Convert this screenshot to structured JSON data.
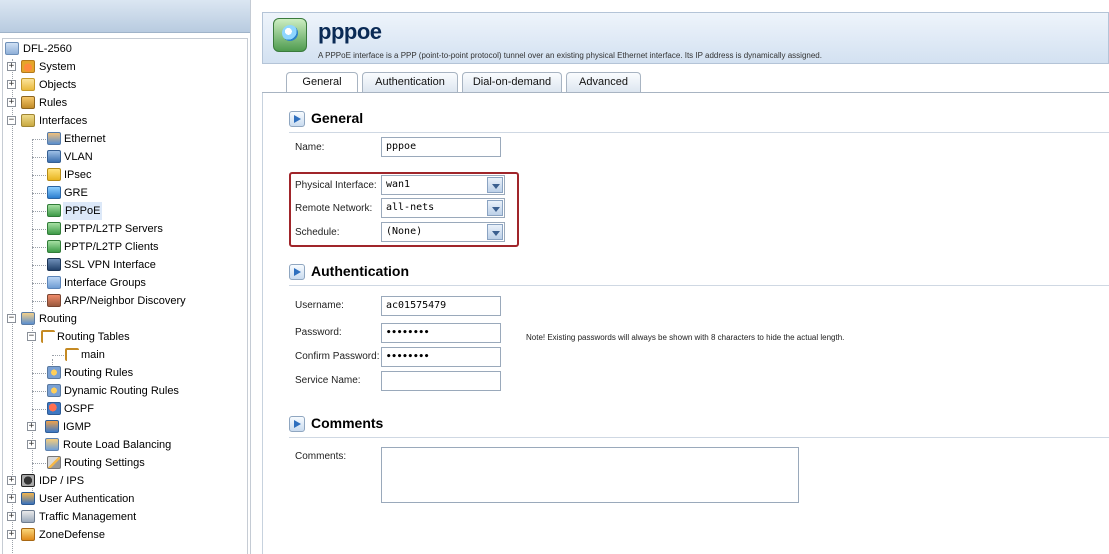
{
  "tree": {
    "items": [
      {
        "label": "DFL-2560"
      },
      {
        "label": "System"
      },
      {
        "label": "Objects"
      },
      {
        "label": "Rules"
      },
      {
        "label": "Interfaces"
      },
      {
        "label": "Ethernet"
      },
      {
        "label": "VLAN"
      },
      {
        "label": "IPsec"
      },
      {
        "label": "GRE"
      },
      {
        "label": "PPPoE"
      },
      {
        "label": "PPTP/L2TP Servers"
      },
      {
        "label": "PPTP/L2TP Clients"
      },
      {
        "label": "SSL VPN Interface"
      },
      {
        "label": "Interface Groups"
      },
      {
        "label": "ARP/Neighbor Discovery"
      },
      {
        "label": "Routing"
      },
      {
        "label": "Routing Tables"
      },
      {
        "label": "main"
      },
      {
        "label": "Routing Rules"
      },
      {
        "label": "Dynamic Routing Rules"
      },
      {
        "label": "OSPF"
      },
      {
        "label": "IGMP"
      },
      {
        "label": "Route Load Balancing"
      },
      {
        "label": "Routing Settings"
      },
      {
        "label": "IDP / IPS"
      },
      {
        "label": "User Authentication"
      },
      {
        "label": "Traffic Management"
      },
      {
        "label": "ZoneDefense"
      }
    ],
    "expand_symbol": "+",
    "collapse_symbol": "−"
  },
  "header": {
    "title": "pppoe",
    "description": "A PPPoE interface is a PPP (point-to-point protocol) tunnel over an existing physical Ethernet interface. Its IP address is dynamically assigned."
  },
  "tabs": [
    "General",
    "Authentication",
    "Dial-on-demand",
    "Advanced"
  ],
  "sections": {
    "general": {
      "title": "General",
      "name_label": "Name:",
      "name_value": "pppoe",
      "physical_label": "Physical Interface:",
      "physical_value": "wan1",
      "remote_label": "Remote Network:",
      "remote_value": "all-nets",
      "schedule_label": "Schedule:",
      "schedule_value": "(None)"
    },
    "authentication": {
      "title": "Authentication",
      "username_label": "Username:",
      "username_value": "ac01575479",
      "password_label": "Password:",
      "password_value": "••••••••",
      "confirm_label": "Confirm Password:",
      "confirm_value": "••••••••",
      "service_label": "Service Name:",
      "service_value": "",
      "note": "Note! Existing passwords will always be shown with 8 characters to hide the actual length."
    },
    "comments": {
      "title": "Comments",
      "comments_label": "Comments:",
      "comments_value": ""
    }
  },
  "colors": {
    "highlight_box": "#a0252a",
    "header_title": "#0a2a55"
  }
}
